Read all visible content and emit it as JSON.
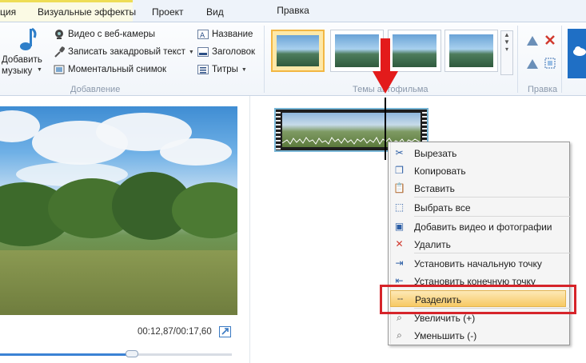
{
  "tabs": {
    "partial_left": "ция",
    "visual_effects": "Визуальные эффекты",
    "project": "Проект",
    "view": "Вид",
    "edit_context": "Правка"
  },
  "ribbon": {
    "add_music": "Добавить\nмузыку",
    "webcam_video": "Видео с веб-камеры",
    "record_narration": "Записать закадровый текст",
    "snapshot": "Моментальный снимок",
    "title": "Название",
    "caption": "Заголовок",
    "credits": "Титры",
    "group_add": "Добавление",
    "group_themes": "Темы автофильма",
    "group_edit": "Правка"
  },
  "player": {
    "timecode": "00:12,87/00:17,60",
    "progress_fraction": 0.569
  },
  "context_menu": {
    "items": [
      {
        "label": "Вырезать",
        "icon": "scissors-icon"
      },
      {
        "label": "Копировать",
        "icon": "copy-icon"
      },
      {
        "label": "Вставить",
        "icon": "paste-icon"
      },
      {
        "label": "Выбрать все",
        "icon": "select-all-icon"
      },
      {
        "label": "Добавить видео и фотографии",
        "icon": "add-media-icon"
      },
      {
        "label": "Удалить",
        "icon": "delete-icon"
      },
      {
        "label": "Установить начальную точку",
        "icon": "set-start-icon"
      },
      {
        "label": "Установить конечную точку",
        "icon": "set-end-icon"
      },
      {
        "label": "Разделить",
        "icon": "split-icon"
      },
      {
        "label": "Увеличить (+)",
        "icon": "zoom-in-icon"
      },
      {
        "label": "Уменьшить (-)",
        "icon": "zoom-out-icon"
      }
    ],
    "highlighted_index": 8
  },
  "colors": {
    "annotation_red": "#d6242a",
    "arrow_red": "#e31b1b",
    "highlight": "#f7c964",
    "accent_blue": "#3b82d4"
  }
}
